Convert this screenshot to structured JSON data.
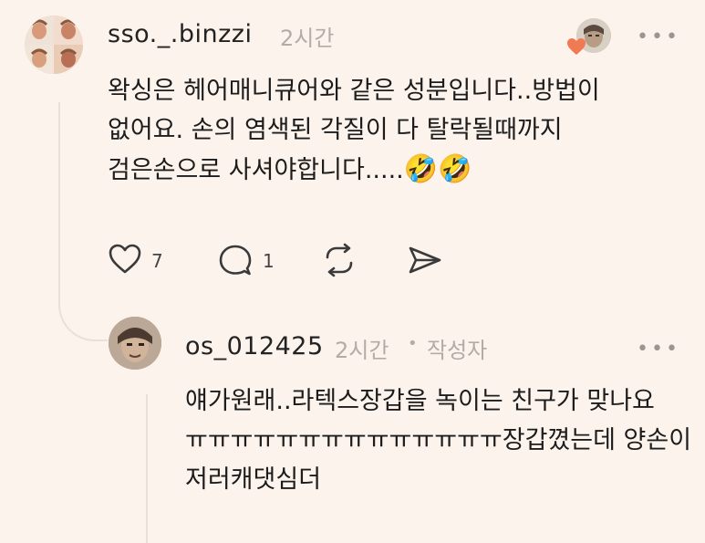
{
  "comment": {
    "username": "sso._.binzzi",
    "time": "2시간",
    "more_label": "•••",
    "lines": [
      "왁싱은 헤어매니큐어와 같은 성분입니다..방법이",
      "없어요.  손의 염색된 각질이 다 탈락될때까지",
      "검은손으로 사셔야합니다....."
    ],
    "emoji": "🤣🤣",
    "likes_count": "7",
    "replies_count": "1",
    "icons": {
      "like": "heart-outline-icon",
      "reply": "comment-bubble-icon",
      "repost": "repost-icon",
      "share": "send-icon",
      "liked_by": "heart-filled-icon"
    },
    "colors": {
      "liked_heart": "#f07a52"
    }
  },
  "reply": {
    "username": "os_012425",
    "time": "2시간",
    "separator": "•",
    "author_badge": "작성자",
    "more_label": "•••",
    "lines": [
      "얘가원래..라텍스장갑을 녹이는 친구가 맞나요",
      "ㅠㅠㅠㅠㅠㅠㅠㅠㅠㅠㅠㅠㅠㅠ장갑꼈는데 양손이",
      "저러캐댓심더"
    ]
  }
}
